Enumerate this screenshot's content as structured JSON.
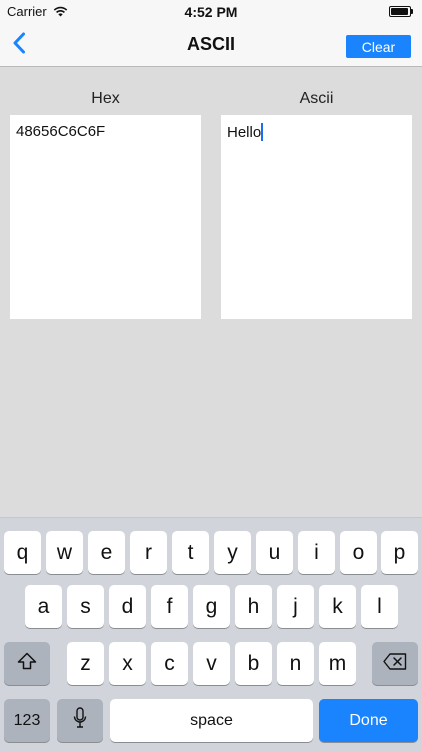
{
  "status_bar": {
    "carrier": "Carrier",
    "time": "4:52 PM"
  },
  "nav": {
    "title": "ASCII",
    "clear_label": "Clear"
  },
  "converter": {
    "hex_label": "Hex",
    "ascii_label": "Ascii",
    "hex_value": "48656C6C6F",
    "ascii_value": "Hello"
  },
  "keyboard": {
    "row1": [
      "q",
      "w",
      "e",
      "r",
      "t",
      "y",
      "u",
      "i",
      "o",
      "p"
    ],
    "row2": [
      "a",
      "s",
      "d",
      "f",
      "g",
      "h",
      "j",
      "k",
      "l"
    ],
    "row3": [
      "z",
      "x",
      "c",
      "v",
      "b",
      "n",
      "m"
    ],
    "numbers_label": "123",
    "space_label": "space",
    "done_label": "Done"
  },
  "colors": {
    "accent": "#1a84ff",
    "background": "#dcdcdc",
    "keyboard_bg": "#d1d5db"
  }
}
